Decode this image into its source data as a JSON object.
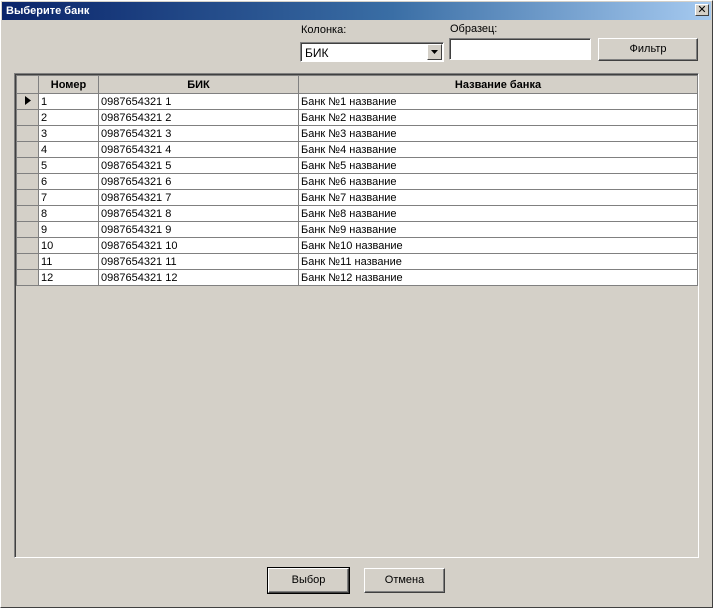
{
  "window": {
    "title": "Выберите банк"
  },
  "filter": {
    "column_label": "Колонка:",
    "column_value": "БИК",
    "pattern_label": "Образец:",
    "pattern_value": "",
    "filter_button": "Фильтр"
  },
  "grid": {
    "columns": [
      "Номер",
      "БИК",
      "Название банка"
    ],
    "rows": [
      {
        "num": "1",
        "bik": "0987654321  1",
        "name": "Банк №1 название"
      },
      {
        "num": "2",
        "bik": "0987654321  2",
        "name": "Банк №2 название"
      },
      {
        "num": "3",
        "bik": "0987654321  3",
        "name": "Банк №3 название"
      },
      {
        "num": "4",
        "bik": "0987654321  4",
        "name": "Банк №4 название"
      },
      {
        "num": "5",
        "bik": "0987654321  5",
        "name": "Банк №5 название"
      },
      {
        "num": "6",
        "bik": "0987654321  6",
        "name": "Банк №6 название"
      },
      {
        "num": "7",
        "bik": "0987654321  7",
        "name": "Банк №7 название"
      },
      {
        "num": "8",
        "bik": "0987654321  8",
        "name": "Банк №8 название"
      },
      {
        "num": "9",
        "bik": "0987654321  9",
        "name": "Банк №9 название"
      },
      {
        "num": "10",
        "bik": "0987654321  10",
        "name": "Банк №10 название"
      },
      {
        "num": "11",
        "bik": "0987654321  11",
        "name": "Банк №11 название"
      },
      {
        "num": "12",
        "bik": "0987654321  12",
        "name": "Банк №12 название"
      }
    ],
    "current_row_icon": "row-pointer-icon"
  },
  "buttons": {
    "select": "Выбор",
    "cancel": "Отмена"
  },
  "icons": {
    "close": "close-icon",
    "dropdown": "chevron-down-icon"
  }
}
